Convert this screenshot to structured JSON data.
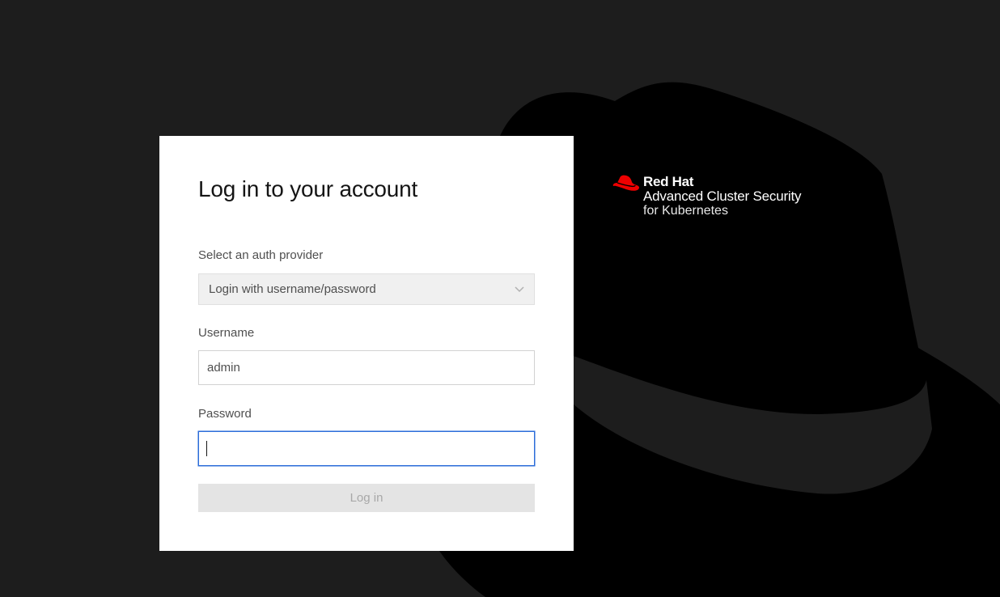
{
  "login": {
    "title": "Log in to your account",
    "auth_provider": {
      "label": "Select an auth provider",
      "selected": "Login with username/password"
    },
    "username": {
      "label": "Username",
      "value": "admin"
    },
    "password": {
      "label": "Password",
      "value": ""
    },
    "submit_label": "Log in"
  },
  "brand": {
    "name": "Red Hat",
    "product": "Advanced Cluster Security",
    "subtitle": "for Kubernetes",
    "logo_icon": "red-hat-fedora-icon",
    "logo_color": "#ee0000"
  },
  "colors": {
    "background": "#1d1d1d",
    "hat_shape": "#000000",
    "focus_border": "#2b6cd9"
  }
}
